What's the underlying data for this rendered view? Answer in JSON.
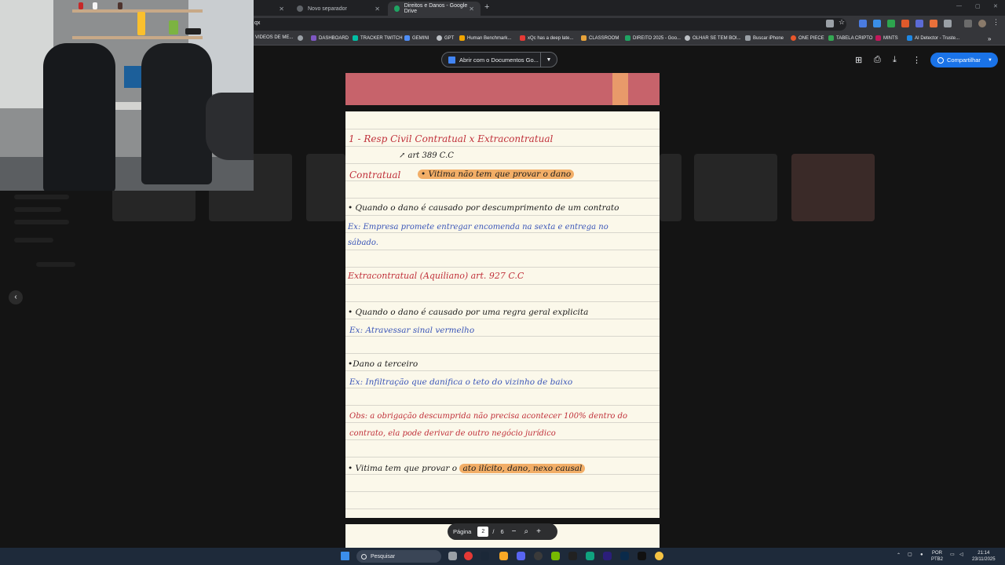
{
  "browser": {
    "tabs": [
      {
        "label": "Novo separador",
        "active": false
      },
      {
        "label": "Direitos e Danos - Google Drive",
        "active": true
      }
    ],
    "address_fragment": "qx",
    "bookmarks": [
      "VIDEOS DE ME...",
      "DASHBOARD",
      "TRACKER TWITCH",
      "GEMINI",
      "GPT",
      "Human Benchmark...",
      "xQc has a deep late...",
      "CLASSROOM",
      "DIREITO 2025 - Goo...",
      "OLHAR SE TEM BOI...",
      "Buscar iPhone",
      "ONE PIECE",
      "TABELA CRIPTO",
      "MINTS",
      "AI Detector - Truste..."
    ]
  },
  "viewer": {
    "open_with_label": "Abrir com o Documentos Go...",
    "share_label": "Compartilhar",
    "pager": {
      "label": "Página",
      "current": "2",
      "separator": "/",
      "total": "6"
    }
  },
  "note": {
    "line1": "1 -   Resp Civil Contratual  x  Extracontratual",
    "line2": "↗ art 389 C.C",
    "contratual_label": "Contratual",
    "contratual_hl": "• Vitima não tem que provar o dano",
    "bullet1": "• Quando o dano é causado por descumprimento de um contrato",
    "ex1a": "Ex: Empresa promete entregar encomenda na sexta e entrega no",
    "ex1b": "sábado.",
    "extra_label": "Extracontratual (Aquiliano)  art. 927 C.C",
    "bullet2": "• Quando o dano é causado por uma regra geral explicita",
    "ex2": "Ex: Atravessar sinal vermelho",
    "bullet3": "•Dano a terceiro",
    "ex3": "Ex: Infiltração que danifica o teto do vizinho de baixo",
    "obs_a": "Obs: a obrigação descumprida não precisa acontecer 100% dentro do",
    "obs_b": "contrato, ela pode derivar de outro negócio jurídico",
    "bullet4_pre": "• Vitima tem que provar o",
    "bullet4_hl": "ato ilícito, dano, nexo causal"
  },
  "taskbar": {
    "search_placeholder": "Pesquisar",
    "lang_top": "POR",
    "lang_bottom": "PTB2",
    "time": "21:14",
    "date": "23/11/2025"
  },
  "colors": {
    "share_blue": "#1a73e8",
    "page_header_red": "#c7636b",
    "highlight_orange": "#f2ae67",
    "ink_red": "#c0303a",
    "ink_blue": "#3b56b8"
  }
}
